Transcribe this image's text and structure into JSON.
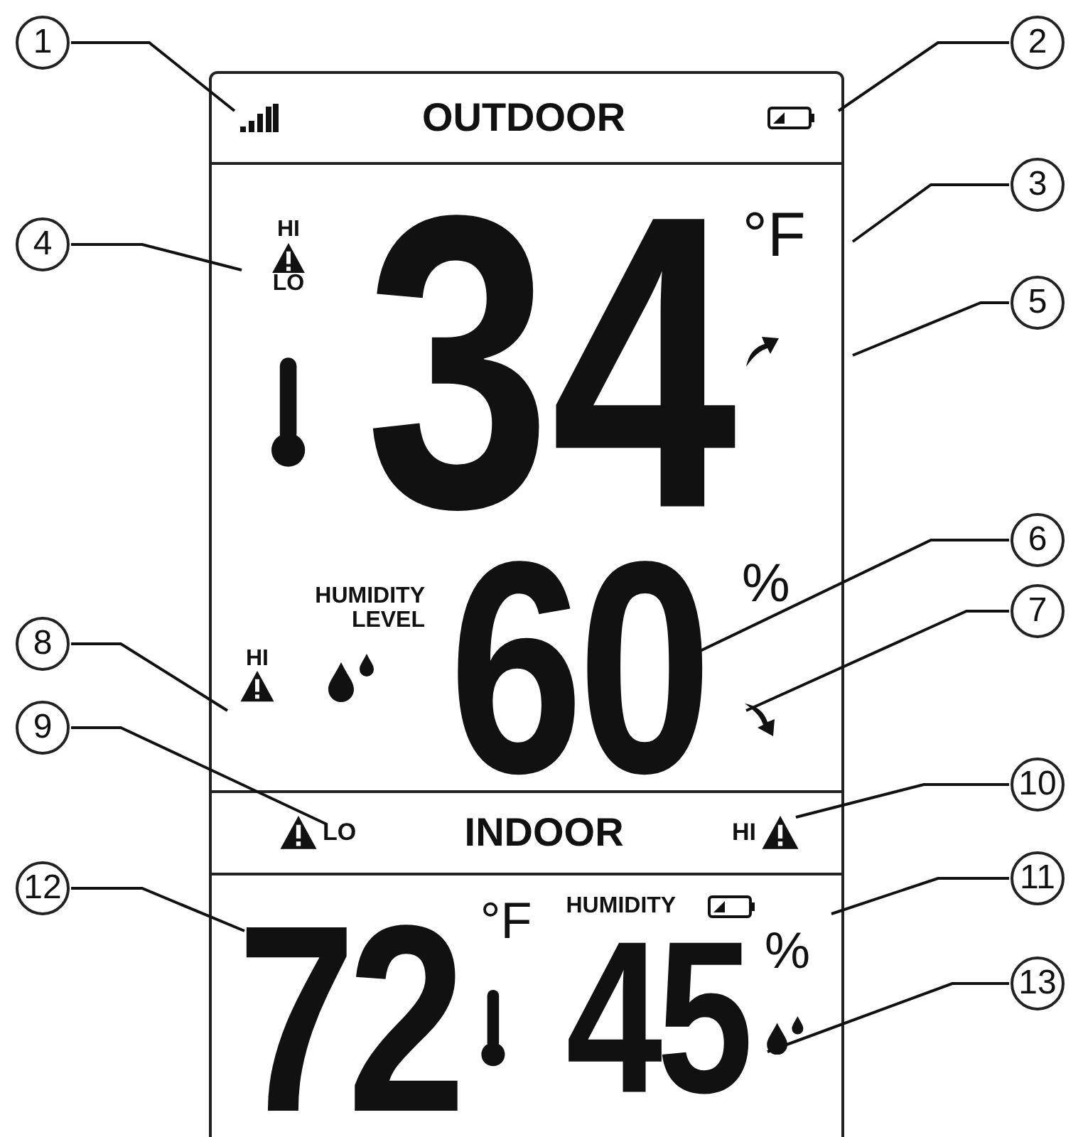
{
  "outdoor": {
    "title": "OUTDOOR",
    "alert_hi": "HI",
    "alert_lo": "LO",
    "temperature": "34",
    "unit": "°F",
    "trend_up": true
  },
  "humidity": {
    "label": "HUMIDITY",
    "label_2": "LEVEL",
    "alert_hi": "HI",
    "value": "60",
    "unit": "%",
    "trend_up": false
  },
  "indoor_bar": {
    "lo_label": "LO",
    "title": "INDOOR",
    "hi_label": "HI"
  },
  "indoor": {
    "temperature": "72",
    "unit": "°F",
    "humidity_label": "HUMIDITY",
    "humidity": "45",
    "humidity_unit": "%"
  },
  "callouts": [
    "1",
    "2",
    "3",
    "4",
    "5",
    "6",
    "7",
    "8",
    "9",
    "10",
    "12",
    "11",
    "13"
  ]
}
